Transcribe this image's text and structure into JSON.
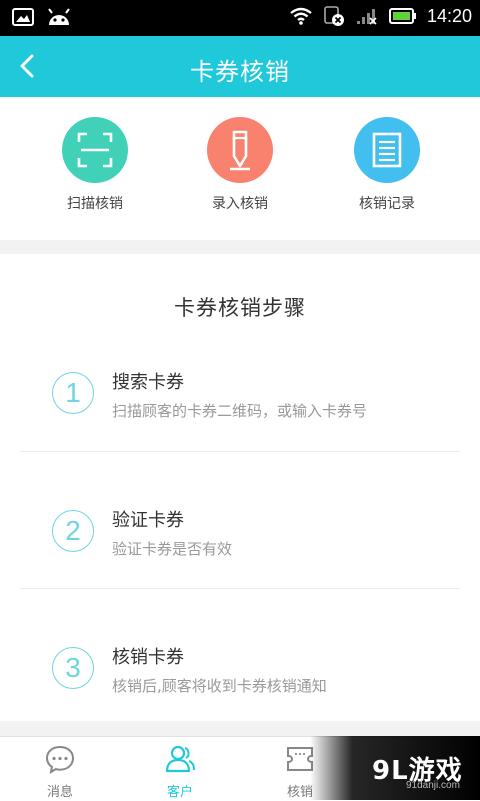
{
  "status_bar": {
    "time": "14:20",
    "icons": [
      "gallery-icon",
      "android-icon",
      "wifi-icon",
      "sim-x-icon",
      "signal-icon",
      "battery-icon"
    ]
  },
  "header": {
    "title": "卡券核销",
    "back_icon": "chevron-left-icon"
  },
  "actions": [
    {
      "label": "扫描核销",
      "icon": "scan-icon",
      "color": "#41d1b8"
    },
    {
      "label": "录入核销",
      "icon": "pen-icon",
      "color": "#f8826e"
    },
    {
      "label": "核销记录",
      "icon": "list-icon",
      "color": "#42bfee"
    }
  ],
  "steps": {
    "title": "卡券核销步骤",
    "items": [
      {
        "num": "1",
        "title": "搜索卡券",
        "desc": "扫描顾客的卡券二维码，或输入卡券号"
      },
      {
        "num": "2",
        "title": "验证卡券",
        "desc": "验证卡券是否有效"
      },
      {
        "num": "3",
        "title": "核销卡券",
        "desc": "核销后,顾客将收到卡券核销通知"
      }
    ]
  },
  "tabs": [
    {
      "label": "消息",
      "icon": "chat-icon"
    },
    {
      "label": "客户",
      "icon": "users-icon"
    },
    {
      "label": "核销",
      "icon": "ticket-icon"
    }
  ],
  "watermark": {
    "logo": "9L游戏",
    "url": "91danji.com"
  },
  "colors": {
    "accent": "#1fc9d9",
    "step_circle": "#6fd5df"
  }
}
